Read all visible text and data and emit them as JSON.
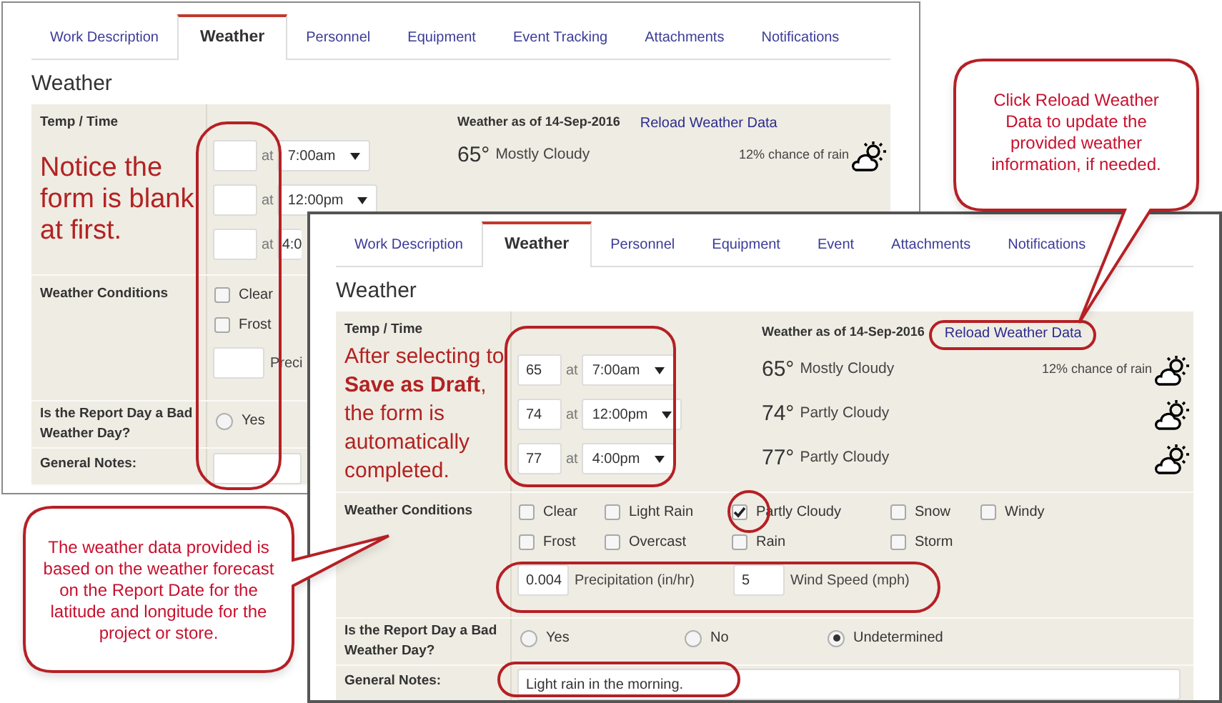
{
  "back_window": {
    "tabs": [
      {
        "label": "Work Description",
        "selected": false
      },
      {
        "label": "Weather",
        "selected": true
      },
      {
        "label": "Personnel",
        "selected": false
      },
      {
        "label": "Equipment",
        "selected": false
      },
      {
        "label": "Event Tracking",
        "selected": false
      },
      {
        "label": "Attachments",
        "selected": false
      },
      {
        "label": "Notifications",
        "selected": false
      }
    ],
    "heading": "Weather",
    "temp_time": {
      "label": "Temp / Time",
      "note": "Notice the form is blank at first.",
      "entries": [
        {
          "at_label": "at",
          "time": "7:00am",
          "caret": true
        },
        {
          "at_label": "at",
          "time": "12:00pm",
          "caret": true
        },
        {
          "at_label": "at",
          "time": "4:0",
          "caret": false
        }
      ],
      "weather_as_of": "Weather as of 14-Sep-2016",
      "reload_link": "Reload Weather Data",
      "forecasts": [
        {
          "temperature": "65°",
          "summary": "Mostly Cloudy",
          "chance": "12% chance of rain"
        }
      ]
    },
    "conditions": {
      "label": "Weather Conditions",
      "rows": [
        [
          {
            "label": "Clear",
            "checked": false
          }
        ],
        [
          {
            "label": "Frost",
            "checked": false
          }
        ]
      ],
      "precipitation": {
        "label": "Preci"
      }
    },
    "bad_weather": {
      "label": "Is the Report Day a Bad Weather Day?",
      "options": [
        {
          "label": "Yes",
          "selected": false
        }
      ]
    },
    "general_notes": {
      "label": "General Notes:"
    }
  },
  "front_window": {
    "tabs": [
      {
        "label": "Work Description",
        "selected": false
      },
      {
        "label": "Weather",
        "selected": true
      },
      {
        "label": "Personnel",
        "selected": false
      },
      {
        "label": "Equipment",
        "selected": false
      },
      {
        "label": "Event",
        "selected": false
      },
      {
        "label": "Attachments",
        "selected": false
      },
      {
        "label": "Notifications",
        "selected": false
      }
    ],
    "heading": "Weather",
    "temp_time": {
      "label": "Temp / Time",
      "note": "After selecting to **Save as Draft**, the form is automatically completed.",
      "entries": [
        {
          "value": "65",
          "at_label": "at",
          "time": "7:00am",
          "caret": true
        },
        {
          "value": "74",
          "at_label": "at",
          "time": "12:00pm",
          "caret": true
        },
        {
          "value": "77",
          "at_label": "at",
          "time": "4:00pm",
          "caret": true
        }
      ],
      "weather_as_of": "Weather as of 14-Sep-2016",
      "reload_link": "Reload Weather Data",
      "forecasts": [
        {
          "temperature": "65°",
          "summary": "Mostly Cloudy",
          "chance": "12% chance of rain"
        },
        {
          "temperature": "74°",
          "summary": "Partly Cloudy"
        },
        {
          "temperature": "77°",
          "summary": "Partly Cloudy"
        }
      ]
    },
    "conditions": {
      "label": "Weather Conditions",
      "rows": [
        [
          {
            "label": "Clear",
            "checked": false
          },
          {
            "label": "Light Rain",
            "checked": false
          },
          {
            "label": "Partly Cloudy",
            "checked": true
          },
          {
            "label": "Snow",
            "checked": false
          },
          {
            "label": "Windy",
            "checked": false
          }
        ],
        [
          {
            "label": "Frost",
            "checked": false
          },
          {
            "label": "Overcast",
            "checked": false
          },
          {
            "label": "Rain",
            "checked": false
          },
          {
            "label": "Storm",
            "checked": false
          }
        ]
      ],
      "precipitation": {
        "value": "0.004",
        "label": "Precipitation (in/hr)"
      },
      "wind_speed": {
        "value": "5",
        "label": "Wind Speed (mph)"
      }
    },
    "bad_weather": {
      "label": "Is the Report Day a Bad Weather Day?",
      "options": [
        {
          "label": "Yes",
          "selected": false
        },
        {
          "label": "No",
          "selected": false
        },
        {
          "label": "Undetermined",
          "selected": true
        }
      ]
    },
    "general_notes": {
      "label": "General Notes:",
      "value": "Light rain in the morning."
    }
  },
  "callouts": [
    {
      "text": "The weather data provided is based on the weather forecast on the Report Date for the latitude and longitude for the project or store."
    },
    {
      "text": "Click Reload Weather Data to update the provided weather information, if needed."
    }
  ]
}
